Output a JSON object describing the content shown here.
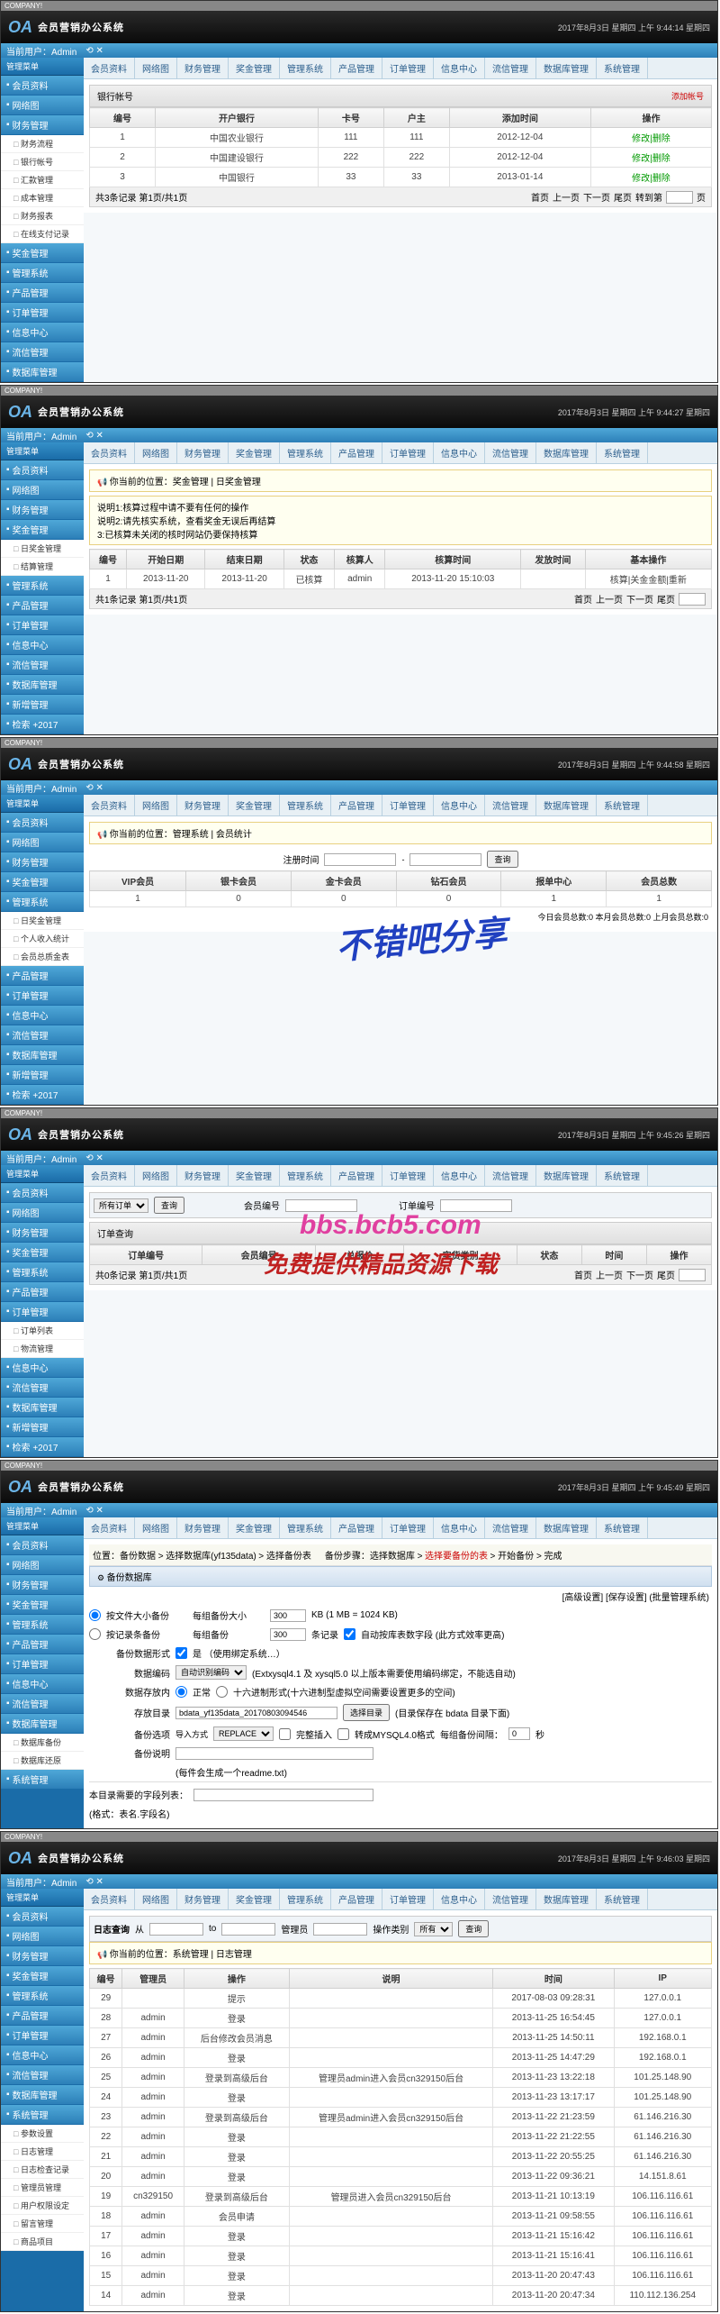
{
  "company": "COMPANY!",
  "logo": "OA",
  "system_name": "会员营销办公系统",
  "screens": [
    {
      "datetime": "2017年8月3日 星期四 上午 9:44:14 星期四",
      "topbar": [
        "当前用户：Admin"
      ],
      "sidebar_title": "管理菜单",
      "sidebar": [
        {
          "label": "会员资料",
          "subs": []
        },
        {
          "label": "网络图",
          "subs": []
        },
        {
          "label": "财务管理",
          "subs": [
            "财务流程",
            "银行帐号",
            "汇款管理",
            "成本管理",
            "财务报表",
            "在线支付记录"
          ]
        },
        {
          "label": "奖金管理",
          "subs": []
        },
        {
          "label": "管理系统",
          "subs": []
        },
        {
          "label": "产品管理",
          "subs": []
        },
        {
          "label": "订单管理",
          "subs": []
        },
        {
          "label": "信息中心",
          "subs": []
        },
        {
          "label": "流信管理",
          "subs": []
        },
        {
          "label": "数据库管理",
          "subs": []
        }
      ],
      "tabs": [
        "会员资料",
        "网络图",
        "财务管理",
        "奖金管理",
        "管理系统",
        "产品管理",
        "订单管理",
        "信息中心",
        "流信管理",
        "数据库管理",
        "系统管理"
      ],
      "panel_title": "银行帐号",
      "panel_action": "添加帐号",
      "table_headers": [
        "编号",
        "开户银行",
        "卡号",
        "户主",
        "添加时间",
        "操作"
      ],
      "table_rows": [
        [
          "1",
          "中国农业银行",
          "111",
          "111",
          "2012-12-04",
          "修改|删除"
        ],
        [
          "2",
          "中国建设银行",
          "222",
          "222",
          "2012-12-04",
          "修改|删除"
        ],
        [
          "3",
          "中国银行",
          "33",
          "33",
          "2013-01-14",
          "修改|删除"
        ]
      ],
      "pager_left": "共3条记录 第1页/共1页",
      "pager_right": [
        "首页",
        "上一页",
        "下一页",
        "尾页",
        "转到第",
        "页"
      ]
    },
    {
      "datetime": "2017年8月3日 星期四 上午 9:44:27 星期四",
      "sidebar": [
        {
          "label": "会员资料"
        },
        {
          "label": "网络图"
        },
        {
          "label": "财务管理"
        },
        {
          "label": "奖金管理",
          "subs": [
            "日奖金管理",
            "结算管理"
          ]
        },
        {
          "label": "管理系统"
        },
        {
          "label": "产品管理"
        },
        {
          "label": "订单管理"
        },
        {
          "label": "信息中心"
        },
        {
          "label": "流信管理"
        },
        {
          "label": "数据库管理"
        },
        {
          "label": "新增管理"
        },
        {
          "label": "检索 +2017"
        }
      ],
      "breadcrumb": "你当前的位置：奖金管理 | 日奖金管理",
      "notices": [
        "说明1:核算过程中请不要有任何的操作",
        "说明2:请先核实系统，查看奖金无误后再结算",
        "3:已核算未关闭的核时网站仍要保持核算"
      ],
      "table_headers": [
        "编号",
        "开始日期",
        "结束日期",
        "状态",
        "核算人",
        "核算时间",
        "发放时间",
        "基本操作"
      ],
      "table_rows": [
        [
          "1",
          "2013-11-20",
          "2013-11-20",
          "已核算",
          "admin",
          "2013-11-20 15:10:03",
          "",
          "核算|关金金额|重新"
        ]
      ],
      "pager_left": "共1条记录 第1页/共1页"
    },
    {
      "datetime": "2017年8月3日 星期四 上午 9:44:58 星期四",
      "sidebar": [
        {
          "label": "会员资料"
        },
        {
          "label": "网络图"
        },
        {
          "label": "财务管理"
        },
        {
          "label": "奖金管理"
        },
        {
          "label": "管理系统",
          "subs": [
            "日奖金管理",
            "个人收入统计",
            "会员总质金表"
          ]
        },
        {
          "label": "产品管理"
        },
        {
          "label": "订单管理"
        },
        {
          "label": "信息中心"
        },
        {
          "label": "流信管理"
        },
        {
          "label": "数据库管理"
        },
        {
          "label": "新增管理"
        },
        {
          "label": "检索 +2017"
        }
      ],
      "breadcrumb": "你当前的位置：管理系统 | 会员统计",
      "search_label": "注册时间",
      "search_btn": "查询",
      "stat_headers": [
        "VIP会员",
        "银卡会员",
        "金卡会员",
        "钻石会员",
        "报单中心",
        "会员总数"
      ],
      "stat_row": [
        "1",
        "0",
        "0",
        "0",
        "1",
        "1"
      ],
      "totals": "今日会员总数:0  本月会员总数:0  上月会员总数:0",
      "watermark": "不错吧分享"
    },
    {
      "datetime": "2017年8月3日 星期四 上午 9:45:26 星期四",
      "sidebar": [
        {
          "label": "会员资料"
        },
        {
          "label": "网络图"
        },
        {
          "label": "财务管理"
        },
        {
          "label": "奖金管理"
        },
        {
          "label": "管理系统"
        },
        {
          "label": "产品管理"
        },
        {
          "label": "订单管理",
          "subs": [
            "订单列表",
            "物流管理"
          ]
        },
        {
          "label": "信息中心"
        },
        {
          "label": "流信管理"
        },
        {
          "label": "数据库管理"
        },
        {
          "label": "新增管理"
        },
        {
          "label": "检索 +2017"
        }
      ],
      "search_row": {
        "sel1": "所有订单",
        "btn": "查询",
        "label2": "会员编号",
        "label3": "订单编号"
      },
      "panel_title": "订单查询",
      "table_headers": [
        "订单编号",
        "会员编号",
        "总报价",
        "实货类别",
        "状态",
        "时间",
        "操作"
      ],
      "pager_left": "共0条记录 第1页/共1页",
      "watermark_url": "bbs.bcb5.com",
      "watermark_text": "免费提供精品资源下载"
    },
    {
      "datetime": "2017年8月3日 星期四 上午 9:45:49 星期四",
      "sidebar": [
        {
          "label": "会员资料"
        },
        {
          "label": "网络图"
        },
        {
          "label": "财务管理"
        },
        {
          "label": "奖金管理"
        },
        {
          "label": "管理系统"
        },
        {
          "label": "产品管理"
        },
        {
          "label": "订单管理"
        },
        {
          "label": "信息中心"
        },
        {
          "label": "流信管理"
        },
        {
          "label": "数据库管理",
          "subs": [
            "数据库备份",
            "数据库还原"
          ]
        },
        {
          "label": "系统管理"
        }
      ],
      "crumb_steps": [
        "位置：备份数据 >",
        "选择数据库(yf135data)",
        "> 选择备份表",
        "备份步骤：选择数据库 >",
        "选择要备份的表",
        "> 开始备份 > 完成"
      ],
      "section_title": "备份数据库",
      "options_link": "[高级设置] [保存设置] (批量管理系统)",
      "form": {
        "r1_label": "按文件大小备份",
        "r1_mid": "每组备份大小",
        "r1_val": "300",
        "r1_unit": "KB (1 MB = 1024 KB)",
        "r2_label": "按记录条备份",
        "r2_mid": "每组备份",
        "r2_val": "300",
        "r2_unit": "条记录",
        "r2_chk": "自动按库表数字段 (此方式效率更高)",
        "r3_label": "备份数据形式",
        "r3_opts": "是 （使用绑定系统…）",
        "r4_label": "数据编码",
        "r4_sel": "自动识别编码",
        "r4_note": "(Extxysql4.1 及 xysql5.0 以上版本需要使用编码绑定，不能选自动)",
        "r5_label": "数据存放内",
        "r5_a": "正常",
        "r5_b": "十六进制形式(十六进制型虚拟空间需要设置更多的空间)",
        "r6_label": "存放目录",
        "r6_val": "bdata_yf135data_20170803094546",
        "r6_btn": "选择目录",
        "r6_note": "(目录保存在 bdata 目录下面)",
        "r7_label": "备份选项",
        "r7_sel": "REPLACE",
        "r7_chk1": "完整插入",
        "r7_chk2": "转成MYSQL4.0格式",
        "r7_lbl": "每组备份间隔：",
        "r7_val": "0",
        "r7_unit": "秒",
        "r8_label": "备份说明",
        "r8_note": "(每件会生成一个readme.txt)",
        "r9_label": "本目录需要的字段列表：",
        "r9_note": "(格式：表名.字段名)"
      }
    },
    {
      "datetime": "2017年8月3日 星期四 上午 9:46:03 星期四",
      "sidebar": [
        {
          "label": "会员资料"
        },
        {
          "label": "网络图"
        },
        {
          "label": "财务管理"
        },
        {
          "label": "奖金管理"
        },
        {
          "label": "管理系统"
        },
        {
          "label": "产品管理"
        },
        {
          "label": "订单管理"
        },
        {
          "label": "信息中心"
        },
        {
          "label": "流信管理"
        },
        {
          "label": "数据库管理"
        },
        {
          "label": "系统管理",
          "subs": [
            "参数设置",
            "日志管理",
            "日志检查记录",
            "管理员管理",
            "用户权限设定",
            "留言管理",
            "商品项目"
          ]
        }
      ],
      "search": {
        "title": "日志查询",
        "l1": "从",
        "l2": "to",
        "l3": "管理员",
        "l4": "操作类别",
        "sel": "所有",
        "btn": "查询"
      },
      "breadcrumb": "你当前的位置：系统管理 | 日志管理",
      "table_headers": [
        "编号",
        "管理员",
        "操作",
        "说明",
        "时间",
        "IP"
      ],
      "table_rows": [
        [
          "29",
          "",
          "提示",
          "",
          "2017-08-03 09:28:31",
          "127.0.0.1"
        ],
        [
          "28",
          "admin",
          "登录",
          "",
          "2013-11-25 16:54:45",
          "127.0.0.1"
        ],
        [
          "27",
          "admin",
          "后台修改会员消息",
          "",
          "2013-11-25 14:50:11",
          "192.168.0.1"
        ],
        [
          "26",
          "admin",
          "登录",
          "",
          "2013-11-25 14:47:29",
          "192.168.0.1"
        ],
        [
          "25",
          "admin",
          "登录到高级后台",
          "管理员admin进入会员cn329150后台",
          "2013-11-23 13:22:18",
          "101.25.148.90"
        ],
        [
          "24",
          "admin",
          "登录",
          "",
          "2013-11-23 13:17:17",
          "101.25.148.90"
        ],
        [
          "23",
          "admin",
          "登录到高级后台",
          "管理员admin进入会员cn329150后台",
          "2013-11-22 21:23:59",
          "61.146.216.30"
        ],
        [
          "22",
          "admin",
          "登录",
          "",
          "2013-11-22 21:22:55",
          "61.146.216.30"
        ],
        [
          "21",
          "admin",
          "登录",
          "",
          "2013-11-22 20:55:25",
          "61.146.216.30"
        ],
        [
          "20",
          "admin",
          "登录",
          "",
          "2013-11-22 09:36:21",
          "14.151.8.61"
        ],
        [
          "19",
          "cn329150",
          "登录到高级后台",
          "管理员进入会员cn329150后台",
          "2013-11-21 10:13:19",
          "106.116.116.61"
        ],
        [
          "18",
          "admin",
          "会员申请",
          "",
          "2013-11-21 09:58:55",
          "106.116.116.61"
        ],
        [
          "17",
          "admin",
          "登录",
          "",
          "2013-11-21 15:16:42",
          "106.116.116.61"
        ],
        [
          "16",
          "admin",
          "登录",
          "",
          "2013-11-21 15:16:41",
          "106.116.116.61"
        ],
        [
          "15",
          "admin",
          "登录",
          "",
          "2013-11-20 20:47:43",
          "106.116.116.61"
        ],
        [
          "14",
          "admin",
          "登录",
          "",
          "2013-11-20 20:47:34",
          "110.112.136.254"
        ]
      ]
    }
  ]
}
